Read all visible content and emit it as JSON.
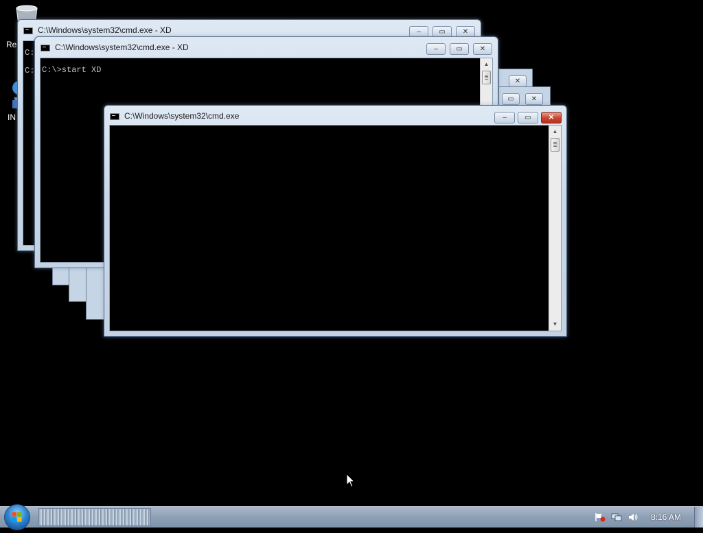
{
  "desktop": {
    "icons": [
      {
        "label": "Rec",
        "icon": "recycle-bin-icon"
      },
      {
        "label": "IN",
        "icon": "internet-explorer-icon"
      }
    ]
  },
  "windows": {
    "back": {
      "title": "C:\\Windows\\system32\\cmd.exe - XD",
      "lines": [
        "C:",
        "C:"
      ]
    },
    "middle": {
      "title": "C:\\Windows\\system32\\cmd.exe - XD",
      "lines": [
        "C:\\>start XD"
      ]
    },
    "front": {
      "title": "C:\\Windows\\system32\\cmd.exe",
      "lines": []
    },
    "controls": {
      "minimize": "–",
      "maximize": "▭",
      "close": "✕"
    }
  },
  "scrollbar": {
    "up": "▲",
    "down": "▼"
  },
  "taskbar": {
    "clock": "8:16 AM",
    "tray_icons": [
      "action-center-flag-icon",
      "network-icon",
      "volume-icon"
    ]
  },
  "colors": {
    "accent": "#c9442c",
    "titlebar": "#c9d8e8",
    "desktop": "#000000"
  }
}
